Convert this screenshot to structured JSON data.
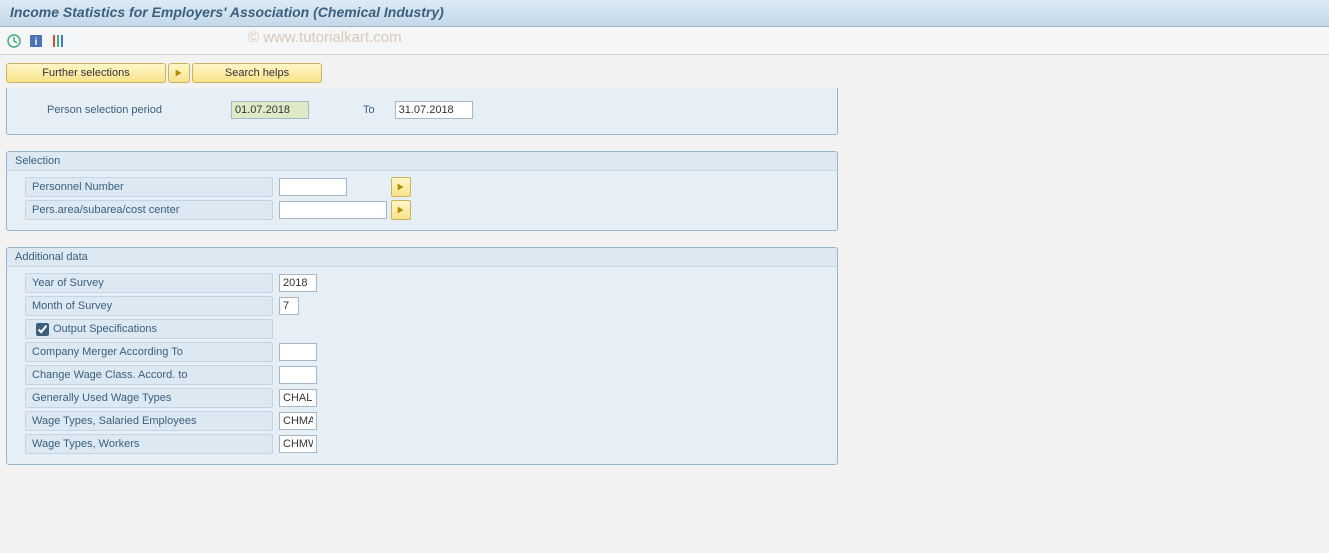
{
  "title": "Income Statistics for Employers' Association (Chemical Industry)",
  "watermark": "© www.tutorialkart.com",
  "toolbar": {
    "execute_icon": "execute",
    "info_icon": "info",
    "variant_icon": "variant"
  },
  "pills": {
    "further_selections": "Further selections",
    "search_helps": "Search helps"
  },
  "period": {
    "label": "Person selection period",
    "from": "01.07.2018",
    "to_label": "To",
    "to": "31.07.2018"
  },
  "selection": {
    "title": "Selection",
    "rows": [
      {
        "label": "Personnel Number",
        "value": "",
        "kind": "short"
      },
      {
        "label": "Pers.area/subarea/cost center",
        "value": "",
        "kind": "long"
      }
    ]
  },
  "additional": {
    "title": "Additional data",
    "year_label": "Year of Survey",
    "year_value": "2018",
    "month_label": "Month of Survey",
    "month_value": "7",
    "output_spec_label": "Output Specifications",
    "output_spec_checked": true,
    "merger_label": "Company Merger According To",
    "merger_value": "",
    "wage_class_label": "Change Wage Class. Accord. to",
    "wage_class_value": "",
    "gen_wage_label": "Generally Used Wage Types",
    "gen_wage_value": "CHAL",
    "sal_wage_label": "Wage Types, Salaried Employees",
    "sal_wage_value": "CHMA",
    "work_wage_label": "Wage Types, Workers",
    "work_wage_value": "CHMW"
  }
}
